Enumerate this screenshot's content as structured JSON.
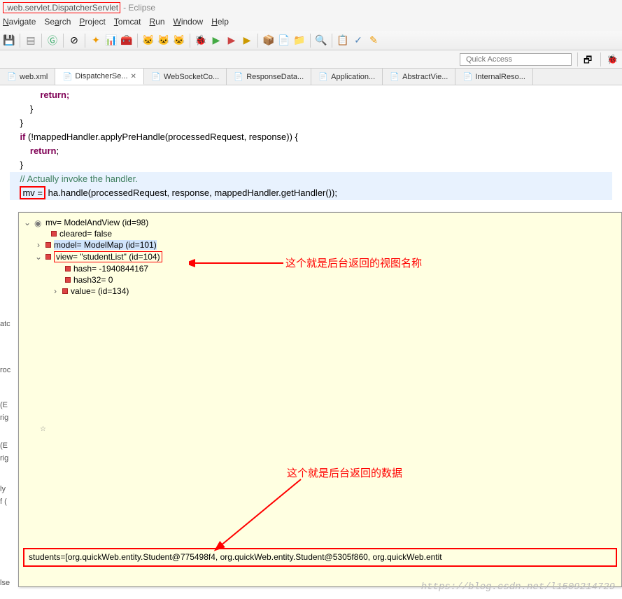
{
  "titleBar": {
    "highlighted": ".web.servlet.DispatcherServlet",
    "rest": " - Eclipse"
  },
  "menu": {
    "navigate": "Navigate",
    "search": "Search",
    "project": "Project",
    "tomcat": "Tomcat",
    "run": "Run",
    "window": "Window",
    "help": "Help"
  },
  "quickAccess": {
    "placeholder": "Quick Access"
  },
  "tabs": {
    "t0": "web.xml",
    "t1": "DispatcherSe...",
    "t2": "WebSocketCo...",
    "t3": "ResponseData...",
    "t4": "Application...",
    "t5": "AbstractVie...",
    "t6": "InternalReso..."
  },
  "code": {
    "l1": "            return;",
    "l2": "        }",
    "l3": "    }",
    "l4": "",
    "l5a": "    if",
    "l5b": " (!mappedHandler.applyPreHandle(processedRequest, response)) {",
    "l6a": "        return",
    "l6b": ";",
    "l7": "    }",
    "l8": "",
    "l9": "    // Actually invoke the handler.",
    "l10a": "    ",
    "l10mv": "mv =",
    "l10b": " ha.handle(processedRequest, response, mappedHandler.getHandler());"
  },
  "debug": {
    "root": "mv= ModelAndView  (id=98)",
    "cleared": "cleared= false",
    "model": "model= ModelMap  (id=101)",
    "view": "view= \"studentList\" (id=104)",
    "hash": "hash= -1940844167",
    "hash32": "hash32= 0",
    "value": "value= (id=134)",
    "data": "students=[org.quickWeb.entity.Student@775498f4, org.quickWeb.entity.Student@5305f860, org.quickWeb.entit"
  },
  "annotations": {
    "a1": "这个就是后台返回的视图名称",
    "a2": "这个就是后台返回的数据"
  },
  "leftClip": {
    "c1": "atc",
    "c2": "roc",
    "c3": "(E",
    "c4": "rig",
    "c5": "(E",
    "c6": "rig",
    "c7": "ly",
    "c8": "f (",
    "c9": "lse"
  },
  "watermark": "https://blog.csdn.net/l1509214729"
}
